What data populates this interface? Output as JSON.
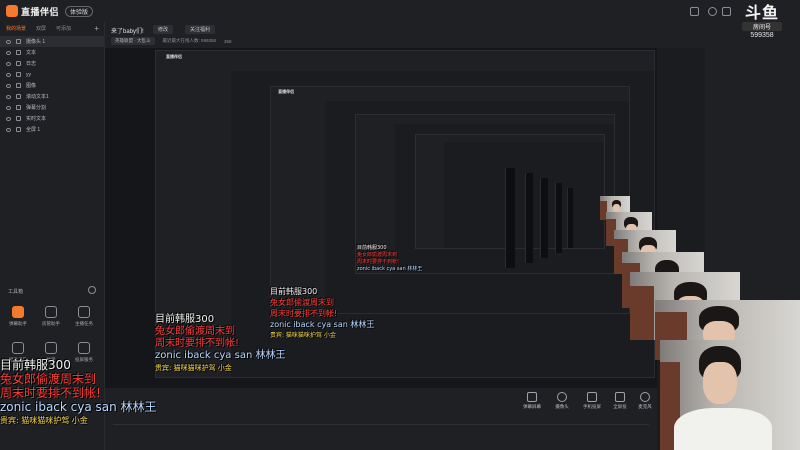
{
  "topbar": {
    "app_name": "直播伴侣",
    "version_badge": "体验版"
  },
  "brand": {
    "logo_text": "斗鱼",
    "sub_label": "房间号",
    "room_number": "599358"
  },
  "scene_tabs": [
    "我的场景",
    "双屏",
    "可添加"
  ],
  "sources": [
    {
      "label": "摄像头 1",
      "selected": true
    },
    {
      "label": "文本",
      "selected": false
    },
    {
      "label": "日志",
      "selected": false
    },
    {
      "label": "yy",
      "selected": false
    },
    {
      "label": "图像",
      "selected": false
    },
    {
      "label": "滚动文本1",
      "selected": false
    },
    {
      "label": "弹幕分割",
      "selected": false
    },
    {
      "label": "实时文本",
      "selected": false
    },
    {
      "label": "全屏 1",
      "selected": false
    }
  ],
  "toolbox": {
    "title": "工具箱",
    "tools": [
      "弹幕助手",
      "房管助手",
      "主播任务",
      "招兵买马",
      "抽奖",
      "投屏服务"
    ]
  },
  "main_head": {
    "title": "来了baby们!",
    "pill1": "修改",
    "pill2": "关注福利",
    "line2_category": "英雄联盟 · 大乱斗",
    "line2_info": "最近最大在线人数: 599358",
    "line2_count": "358"
  },
  "bottom_buttons": [
    "弹幕屏幕",
    "摄像头",
    "手机投屏",
    "全屏投",
    "麦克风"
  ],
  "chat": {
    "line1": "目前韩服300",
    "line2": "兔女郎偷渡周末到",
    "line3": "周末时要排不到帐!",
    "line4": "zonic iback cya san 林林王",
    "line5": "贵宾: 猫咪猫咪护驾 小金"
  },
  "colors": {
    "accent": "#f47a2d",
    "chat_red": "#ff3b38",
    "chat_blue": "#b8d8ff",
    "chat_yellow": "#f7d64a"
  }
}
